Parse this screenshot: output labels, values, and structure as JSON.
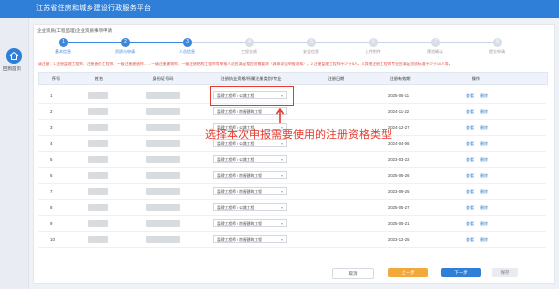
{
  "app": {
    "title": "江苏省住房和城乡建设行政服务平台",
    "home_label": "回到首页"
  },
  "breadcrumb": "企业资质(工程监理)企业资质事项申请",
  "steps": [
    {
      "label": "基本信息",
      "state": "done"
    },
    {
      "label": "资质与申请",
      "state": "done"
    },
    {
      "label": "人员信息",
      "state": "current"
    },
    {
      "label": "工程业绩",
      "state": "todo"
    },
    {
      "label": "安全信息",
      "state": "todo"
    },
    {
      "label": "上传附件",
      "state": "todo"
    },
    {
      "label": "预览确认",
      "state": "todo"
    },
    {
      "label": "提交申请",
      "state": "todo"
    }
  ],
  "notice": "请注意：1.注册监理工程师、注册造价工程师、一级注册建造师……一级注册建筑师、一级注册结构工程师等申报人员应满足相应资格要求（具体详见申报须知），2.注册监理工程师不少于5人，3.其他注册工程师专业应满足资质标准不少于10人等。",
  "table": {
    "headers": [
      "序号",
      "姓名",
      "身份证号码",
      "注册执业资格/所属注册类别/专业",
      "注册日期",
      "注册有效期",
      "操作"
    ],
    "rows": [
      {
        "index": "1",
        "qualification": "监理工程师 / 公路工程",
        "date": "2025-05-11",
        "actions": [
          "查看",
          "删除"
        ]
      },
      {
        "index": "2",
        "qualification": "监理工程师 / 房屋建筑工程",
        "date": "2024-11-22",
        "actions": [
          "查看",
          "删除"
        ]
      },
      {
        "index": "3",
        "qualification": "监理工程师 / 公路工程",
        "date": "2024-12-27",
        "actions": [
          "查看",
          "删除"
        ]
      },
      {
        "index": "4",
        "qualification": "监理工程师 / 公路工程",
        "date": "2024-04-06",
        "actions": [
          "查看",
          "删除"
        ]
      },
      {
        "index": "5",
        "qualification": "监理工程师 / 公路工程",
        "date": "2023-03-22",
        "actions": [
          "查看",
          "删除"
        ]
      },
      {
        "index": "6",
        "qualification": "监理工程师 / 房屋建筑工程",
        "date": "2025-06-26",
        "actions": [
          "查看",
          "删除"
        ]
      },
      {
        "index": "7",
        "qualification": "监理工程师 / 房屋建筑工程",
        "date": "2023-09-25",
        "actions": [
          "查看",
          "删除"
        ]
      },
      {
        "index": "8",
        "qualification": "监理工程师 / 公路工程",
        "date": "2025-05-27",
        "actions": [
          "查看",
          "删除"
        ]
      },
      {
        "index": "9",
        "qualification": "监理工程师 / 房屋建筑工程",
        "date": "2025-05-21",
        "actions": [
          "查看",
          "删除"
        ]
      },
      {
        "index": "10",
        "qualification": "监理工程师 / 房屋建筑工程",
        "date": "2023-12-25",
        "actions": [
          "查看",
          "删除"
        ]
      }
    ]
  },
  "annotation": "选择本次申报需要使用的注册资格类型",
  "buttons": {
    "cancel": "取消",
    "prev": "上一步",
    "next": "下一步",
    "save": "保存"
  },
  "colors": {
    "primary": "#2f7fd8",
    "annotation": "#e53a2e",
    "prev_button": "#f2a93c"
  },
  "icons": {
    "home": "home-icon",
    "select": "chevron-down-icon"
  }
}
